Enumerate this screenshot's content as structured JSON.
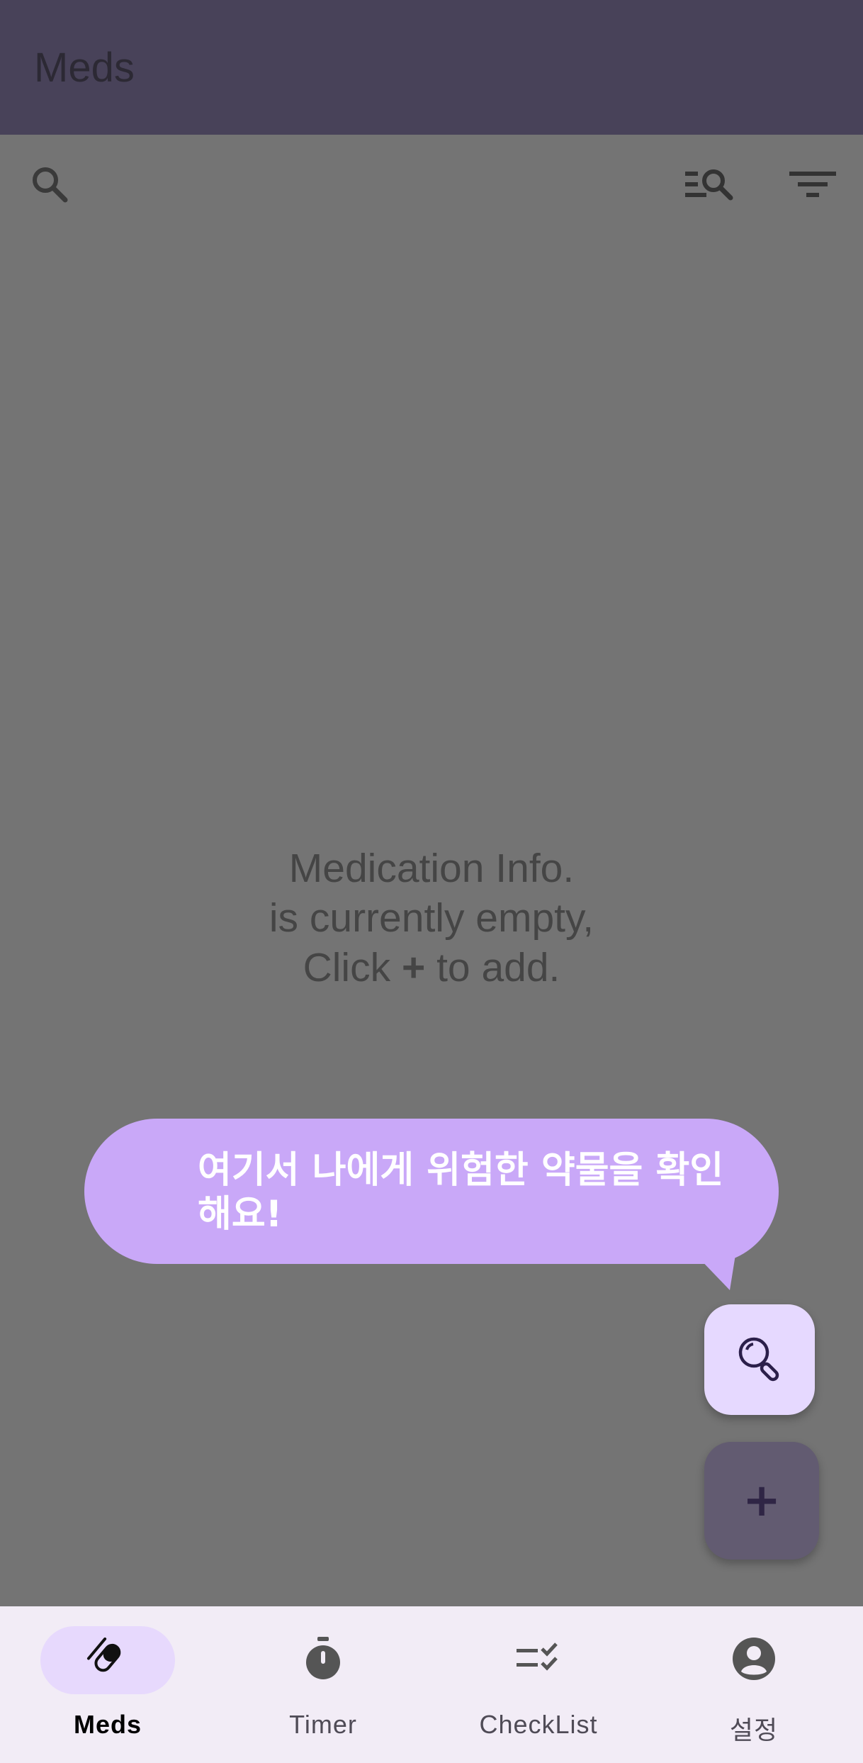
{
  "app_bar": {
    "title": "Meds"
  },
  "toolbar": {
    "search_icon": "search-icon",
    "list_search_icon": "list-search-icon",
    "filter_icon": "filter-icon"
  },
  "empty_state": {
    "line1": "Medication Info.",
    "line2": "is currently empty,",
    "line3_prefix": "Click ",
    "line3_symbol": "+",
    "line3_suffix": " to add."
  },
  "tooltip": {
    "text": "여기서 나에게 위험한 약물을 확인해요!"
  },
  "fabs": {
    "search_icon": "magnifier-icon",
    "add_symbol": "+"
  },
  "bottom_nav": {
    "items": [
      {
        "label": "Meds",
        "icon": "pill-icon",
        "active": true
      },
      {
        "label": "Timer",
        "icon": "stopwatch-icon",
        "active": false
      },
      {
        "label": "CheckList",
        "icon": "checklist-icon",
        "active": false
      },
      {
        "label": "설정",
        "icon": "account-icon",
        "active": false
      }
    ]
  },
  "colors": {
    "app_bar": "#484259",
    "scrim": "#747474",
    "tooltip": "#c9a8f8",
    "nav_bg": "#f2ecf6",
    "nav_active_pill": "#e7d9fd"
  }
}
